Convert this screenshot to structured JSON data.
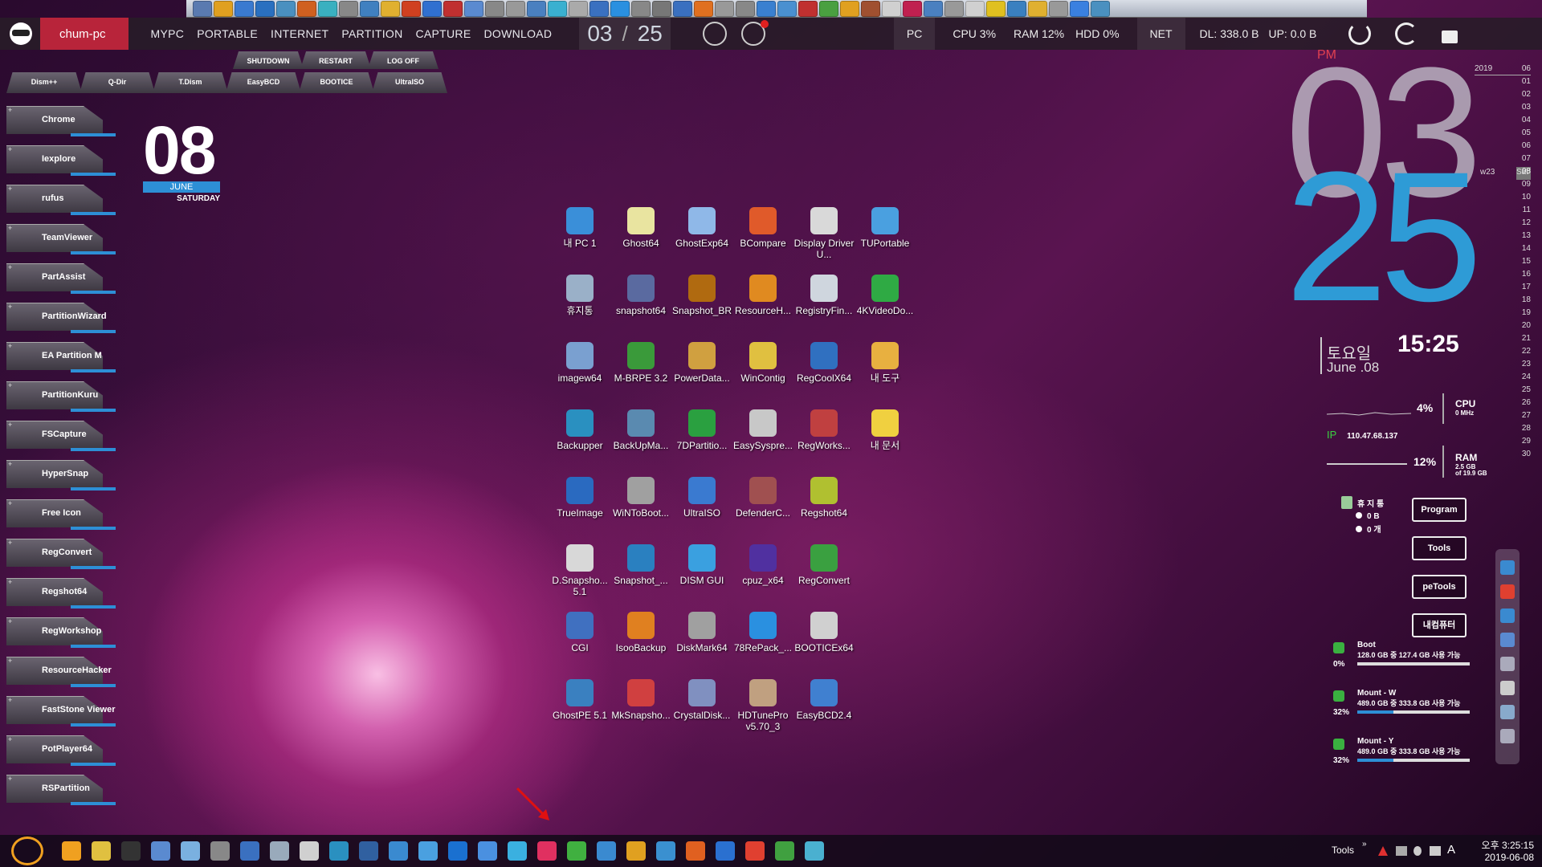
{
  "menubar": {
    "pc_name": "chum-pc",
    "items": [
      "MYPC",
      "PORTABLE",
      "INTERNET",
      "PARTITION",
      "CAPTURE",
      "DOWNLOAD"
    ],
    "hour": "03",
    "minute": "25",
    "pc_label": "PC",
    "cpu": "CPU  3%",
    "ram": "RAM  12%",
    "hdd": "HDD  0%",
    "net_label": "NET",
    "dl": "DL: 338.0 B",
    "up": "UP: 0.0 B"
  },
  "power_tabs": [
    "SHUTDOWN",
    "RESTART",
    "LOG OFF"
  ],
  "tool_tabs": [
    "Dism++",
    "Q-Dir",
    "T.Dism",
    "EasyBCD",
    "BOOTICE",
    "UltraISO"
  ],
  "launchers": [
    "Chrome",
    "Iexplore",
    "rufus",
    "TeamViewer",
    "PartAssist",
    "PartitionWizard",
    "EA Partition M",
    "PartitionKuru",
    "FSCapture",
    "HyperSnap",
    "Free Icon",
    "RegConvert",
    "Regshot64",
    "RegWorkshop",
    "ResourceHacker",
    "FastStone Viewer",
    "PotPlayer64",
    "RSPartition"
  ],
  "date_widget": {
    "day": "08",
    "month": "JUNE",
    "weekday": "SATURDAY"
  },
  "desktop_icons": [
    [
      "내 PC 1",
      "Ghost64",
      "GhostExp64",
      "BCompare",
      "Display Driver U...",
      "TUPortable"
    ],
    [
      "휴지통",
      "snapshot64",
      "Snapshot_BR",
      "ResourceH...",
      "RegistryFin...",
      "4KVideoDo..."
    ],
    [
      "imagew64",
      "M-BRPE 3.2",
      "PowerData...",
      "WinContig",
      "RegCoolX64",
      "내 도구"
    ],
    [
      "Backupper",
      "BackUpMa...",
      "7DPartitio...",
      "EasySyspre...",
      "RegWorks...",
      "내 문서"
    ],
    [
      "TrueImage",
      "WiNToBoot...",
      "UltraISO",
      "DefenderC...",
      "Regshot64"
    ],
    [
      "D.Snapsho... 5.1",
      "Snapshot_...",
      "DISM GUI",
      "cpuz_x64",
      "RegConvert"
    ],
    [
      "CGI",
      "IsooBackup",
      "DiskMark64",
      "78RePack_...",
      "BOOTICEx64"
    ],
    [
      "GhostPE 5.1",
      "MkSnapsho...",
      "CrystalDisk...",
      "HDTunePro v5.70_3",
      "EasyBCD2.4"
    ]
  ],
  "icon_colors": [
    "#3a8fd9",
    "#e9e4a0",
    "#8fb8e8",
    "#e05a2a",
    "#d9d9d9",
    "#4aa0e0",
    "#9ab0c8",
    "#5a6aa0",
    "#b06a10",
    "#e08a20",
    "#cfd6de",
    "#2faa44",
    "#7aa0d0",
    "#3a9a3a",
    "#d0a040",
    "#e0c040",
    "#3070c0",
    "#e8b040",
    "#2a90c0",
    "#5a8ab0",
    "#2aa040",
    "#c8c8c8",
    "#c04040",
    "#f0d040",
    "#2a6ac0",
    "#a0a0a0",
    "#3a7ad0",
    "#a05050",
    "#b0c030",
    "#d8d8d8",
    "#2a80c0",
    "#3aa0e0",
    "#5030a0",
    "#3aa040",
    "#4070c0",
    "#e08020",
    "#a0a0a0",
    "#2a90e0",
    "#d0d0d0",
    "#3a80c0",
    "#d04040",
    "#8090c0",
    "#c0a080",
    "#4080d0"
  ],
  "clock": {
    "ampm": "PM",
    "hour": "03",
    "minute": "25",
    "time": "15:25",
    "korean_day": "토요일",
    "date": "June .08"
  },
  "calendar": {
    "year": "2019",
    "month": "06",
    "week": "w23",
    "today": "08",
    "today_label": "Sat",
    "days": [
      "01",
      "02",
      "03",
      "04",
      "05",
      "06",
      "07",
      "08",
      "09",
      "10",
      "11",
      "12",
      "13",
      "14",
      "15",
      "16",
      "17",
      "18",
      "19",
      "20",
      "21",
      "22",
      "23",
      "24",
      "25",
      "26",
      "27",
      "28",
      "29",
      "30"
    ]
  },
  "sysmon": {
    "cpu_pct": "4%",
    "cpu_label": "CPU",
    "cpu_mhz": "0 MHz",
    "ip_label": "IP",
    "ip": "110.47.68.137",
    "ram_pct": "12%",
    "ram_label": "RAM",
    "ram_used": "2.5 GB",
    "ram_total": "of 19.9 GB"
  },
  "recycle": {
    "title": "휴 지 통",
    "size": "0 B",
    "count": "0 개"
  },
  "right_buttons": [
    "Program",
    "Tools",
    "peTools",
    "내컴퓨터"
  ],
  "drives": [
    {
      "name": "Boot",
      "info": "128.0 GB 중 127.4 GB 사용 가능",
      "pct": "0%",
      "fill": 0.0
    },
    {
      "name": "Mount - W",
      "info": "489.0 GB 중 333.8 GB 사용 가능",
      "pct": "32%",
      "fill": 0.32
    },
    {
      "name": "Mount - Y",
      "info": "489.0 GB 중 333.8 GB 사용 가능",
      "pct": "32%",
      "fill": 0.32
    }
  ],
  "tray": {
    "tools_label": "Tools",
    "ime": "A",
    "time": "오후 3:25:15",
    "date": "2019-06-08"
  },
  "taskbar_colors": [
    "#f0a020",
    "#e0c040",
    "#333",
    "#5a8ad0",
    "#7ab0e0",
    "#888",
    "#3a70c0",
    "#9ab",
    "#d0d0d0",
    "#2a90c0",
    "#3060a0",
    "#3a8ad0",
    "#4aa0e0",
    "#1a70d0",
    "#4a90e0",
    "#3ab0e0",
    "#e03060",
    "#40b040",
    "#3a8ad0",
    "#e0a020",
    "#3a90d0",
    "#e06020",
    "#2a70d0",
    "#e04030",
    "#40a040",
    "#4ab0d0"
  ]
}
